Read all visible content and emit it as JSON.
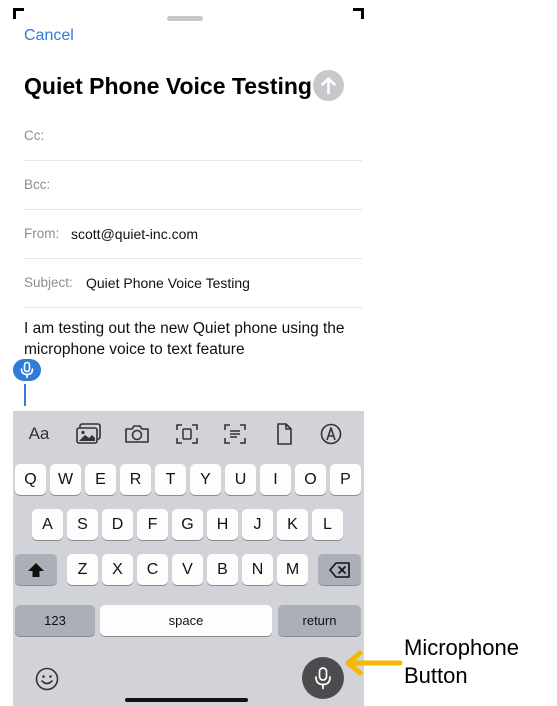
{
  "compose": {
    "cancel_label": "Cancel",
    "title": "Quiet Phone Voice Testing",
    "cc_label": "Cc:",
    "bcc_label": "Bcc:",
    "from_label": "From:",
    "from_value": "scott@quiet-inc.com",
    "subject_label": "Subject:",
    "subject_value": "Quiet Phone Voice Testing",
    "body": "I am testing out the new Quiet phone using the microphone voice to text feature"
  },
  "toolbar": {
    "format_label": "Aa",
    "icons": [
      "photo-library-icon",
      "camera-icon",
      "scan-document-icon",
      "scan-text-icon",
      "attach-file-icon",
      "markup-icon"
    ]
  },
  "keyboard": {
    "row1": [
      "Q",
      "W",
      "E",
      "R",
      "T",
      "Y",
      "U",
      "I",
      "O",
      "P"
    ],
    "row2": [
      "A",
      "S",
      "D",
      "F",
      "G",
      "H",
      "J",
      "K",
      "L"
    ],
    "row3": [
      "Z",
      "X",
      "C",
      "V",
      "B",
      "N",
      "M"
    ],
    "numbers_label": "123",
    "space_label": "space",
    "return_label": "return",
    "shift_icon": "shift-icon",
    "delete_icon": "delete-icon",
    "emoji_icon": "emoji-icon",
    "mic_icon": "microphone-icon"
  },
  "annotation": {
    "text": "Microphone Button",
    "arrow_color": "#f5b800"
  },
  "colors": {
    "accent": "#2f7bd8",
    "keyboard_bg": "#d1d3d9",
    "mic_button_bg": "#4c4c4f"
  }
}
